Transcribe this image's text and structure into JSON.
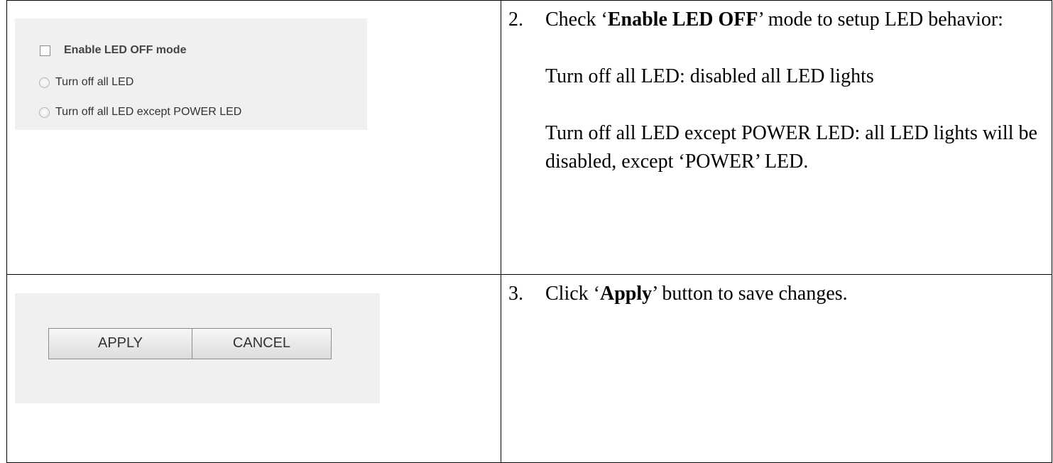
{
  "led_settings": {
    "enable_checkbox": {
      "label": "Enable LED OFF mode",
      "checked": false
    },
    "radio_options": [
      {
        "label": "Turn off all LED",
        "selected": false
      },
      {
        "label": "Turn off all LED except POWER LED",
        "selected": false
      }
    ],
    "panel_color": "#f0f0f0"
  },
  "step2": {
    "number": "2.",
    "line1_pre": "Check ‘",
    "line1_bold": "Enable LED OFF",
    "line1_post": "’ mode to setup LED behavior:",
    "para2": "Turn off all LED: disabled all LED lights",
    "para3": "Turn off all LED except POWER LED: all LED lights will be disabled, except ‘POWER’ LED."
  },
  "buttons": {
    "apply": "APPLY",
    "cancel": "CANCEL"
  },
  "step3": {
    "number": "3.",
    "pre": "Click ‘",
    "bold": "Apply",
    "post": "’ button to save changes."
  }
}
